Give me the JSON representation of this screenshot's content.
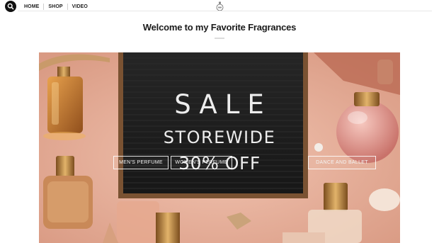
{
  "nav": {
    "items": [
      "HOME",
      "SHOP",
      "VIDEO"
    ]
  },
  "hero": {
    "heading": "Welcome to my Favorite Fragrances",
    "board_line1": "SALE",
    "board_line2": "STOREWIDE",
    "board_line3": "30% OFF",
    "categories": [
      "MEN'S PERFUME",
      "WOMEN'S PERFUME",
      "DANCE AND BALLET"
    ]
  },
  "icons": {
    "search": "search-icon",
    "logo": "perfume-bottle-logo-icon"
  },
  "colors": {
    "background": "#ffffff",
    "search_button": "#111111",
    "heading_text": "#1a1a1a",
    "hero_backdrop": "#e9b7a4",
    "board_frame": "#7a5232",
    "board_felt": "#1f1f1f",
    "board_letters": "#ededed"
  }
}
